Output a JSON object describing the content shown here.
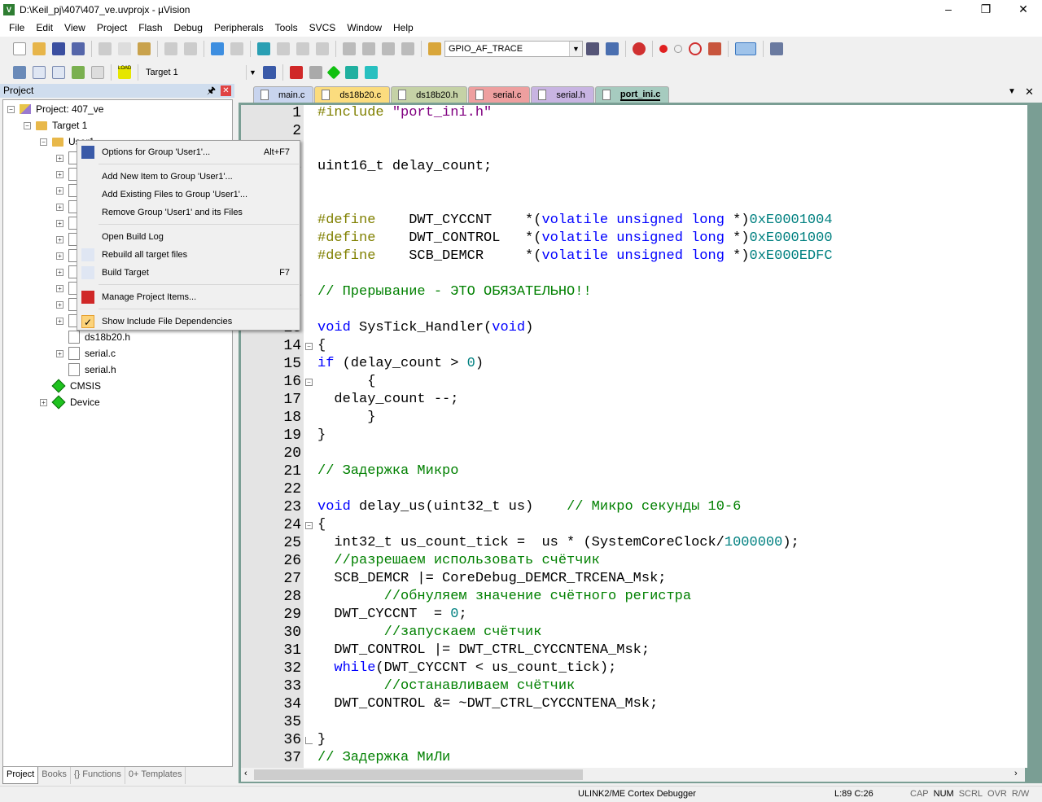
{
  "window": {
    "title": "D:\\Keil_pj\\407\\407_ve.uvprojx - µVision",
    "logo": "V",
    "controls": [
      "minimize-icon",
      "restore-icon",
      "close-icon"
    ]
  },
  "menubar": [
    "File",
    "Edit",
    "View",
    "Project",
    "Flash",
    "Debug",
    "Peripherals",
    "Tools",
    "SVCS",
    "Window",
    "Help"
  ],
  "toolbar1": {
    "find_combo": "GPIO_AF_TRACE"
  },
  "toolbar2": {
    "target_combo": "Target 1",
    "load_label": "LOAD"
  },
  "project_panel": {
    "title": "Project",
    "tree": [
      {
        "label": "Project: 407_ve",
        "level": 0,
        "icon": "project-icon",
        "expander": "minus"
      },
      {
        "label": "Target 1",
        "level": 1,
        "icon": "target-folder-icon",
        "expander": "minus"
      },
      {
        "label": "User1",
        "level": 2,
        "icon": "open-folder-icon",
        "expander": "minus"
      },
      {
        "label": "ds18b20.h",
        "level": 3,
        "icon": "file-icon",
        "expander": ""
      },
      {
        "label": "serial.c",
        "level": 3,
        "icon": "c-file-icon",
        "expander": "plus"
      },
      {
        "label": "serial.h",
        "level": 3,
        "icon": "file-icon",
        "expander": ""
      },
      {
        "label": "CMSIS",
        "level": 2,
        "icon": "component-icon",
        "expander": ""
      },
      {
        "label": "Device",
        "level": 2,
        "icon": "component-icon",
        "expander": "plus"
      }
    ],
    "bottom_tabs": [
      "Project",
      "Books",
      "{} Functions",
      "0+ Templates"
    ]
  },
  "context_menu": [
    {
      "label": "Options for Group 'User1'...",
      "shortcut": "Alt+F7",
      "icon": "magic-wand-icon"
    },
    {
      "sep": true
    },
    {
      "label": "Add New  Item to Group 'User1'...",
      "shortcut": ""
    },
    {
      "label": "Add Existing Files to Group 'User1'...",
      "shortcut": ""
    },
    {
      "label": "Remove Group 'User1' and its Files",
      "shortcut": ""
    },
    {
      "sep": true
    },
    {
      "label": "Open Build Log",
      "shortcut": ""
    },
    {
      "label": "Rebuild all target files",
      "shortcut": "",
      "icon": "rebuild-icon"
    },
    {
      "label": "Build Target",
      "shortcut": "F7",
      "icon": "build-icon"
    },
    {
      "sep": true
    },
    {
      "label": "Manage Project Items...",
      "shortcut": "",
      "icon": "manage-items-icon"
    },
    {
      "sep": true
    },
    {
      "label": "Show Include File Dependencies",
      "shortcut": "",
      "icon": "checkmark-icon",
      "checked": true
    }
  ],
  "editor_tabs": [
    {
      "label": "main.c",
      "color": "#c8d4ee"
    },
    {
      "label": "ds18b20.c",
      "color": "#fbdc7e"
    },
    {
      "label": "ds18b20.h",
      "color": "#c5d2a6"
    },
    {
      "label": "serial.c",
      "color": "#ee9f9f"
    },
    {
      "label": "serial.h",
      "color": "#c8b4e2"
    },
    {
      "label": "port_ini.c",
      "color": "#a6cbbf",
      "active": true
    }
  ],
  "colors": {
    "keyword": "#0000ff",
    "preprocessor": "#808000",
    "string": "#800080",
    "comment": "#008000",
    "number": "#008080"
  },
  "code": [
    [
      [
        "#include ",
        "pp"
      ],
      [
        "\"port_ini.h\"",
        "str"
      ]
    ],
    [],
    [],
    [
      [
        "uint16_t delay_count;",
        "tx"
      ]
    ],
    [],
    [],
    [
      [
        "#define",
        "pp"
      ],
      [
        "    DWT_CYCCNT    *(",
        "tx"
      ],
      [
        "volatile unsigned long",
        "kw"
      ],
      [
        " *)",
        "tx"
      ],
      [
        "0xE0001004",
        "num"
      ]
    ],
    [
      [
        "#define",
        "pp"
      ],
      [
        "    DWT_CONTROL   *(",
        "tx"
      ],
      [
        "volatile unsigned long",
        "kw"
      ],
      [
        " *)",
        "tx"
      ],
      [
        "0xE0001000",
        "num"
      ]
    ],
    [
      [
        "#define",
        "pp"
      ],
      [
        "    SCB_DEMCR     *(",
        "tx"
      ],
      [
        "volatile unsigned long",
        "kw"
      ],
      [
        " *)",
        "tx"
      ],
      [
        "0xE000EDFC",
        "num"
      ]
    ],
    [],
    [
      [
        "// Прерывание - ЭТО ОБЯЗАТЕЛЬНО!!",
        "cm"
      ]
    ],
    [],
    [
      [
        "void",
        "kw"
      ],
      [
        " SysTick_Handler(",
        "tx"
      ],
      [
        "void",
        "kw"
      ],
      [
        ")",
        "tx"
      ]
    ],
    [
      [
        "{",
        "tx"
      ]
    ],
    [
      [
        "if",
        "kw"
      ],
      [
        " (delay_count > ",
        "tx"
      ],
      [
        "0",
        "num"
      ],
      [
        ")",
        "tx"
      ]
    ],
    [
      [
        "      {",
        "tx"
      ]
    ],
    [
      [
        "  delay_count --;",
        "tx"
      ]
    ],
    [
      [
        "      }",
        "tx"
      ]
    ],
    [
      [
        "}",
        "tx"
      ]
    ],
    [],
    [
      [
        "// Задержка Микро",
        "cm"
      ]
    ],
    [],
    [
      [
        "void",
        "kw"
      ],
      [
        " delay_us(uint32_t us)    ",
        "tx"
      ],
      [
        "// Микро секунды 10-6",
        "cm"
      ]
    ],
    [
      [
        "{",
        "tx"
      ]
    ],
    [
      [
        "  int32_t us_count_tick =  us * (SystemCoreClock/",
        "tx"
      ],
      [
        "1000000",
        "num"
      ],
      [
        ");",
        "tx"
      ]
    ],
    [
      [
        "  //разрешаем использовать счётчик",
        "cm"
      ]
    ],
    [
      [
        "  SCB_DEMCR |= CoreDebug_DEMCR_TRCENA_Msk;",
        "tx"
      ]
    ],
    [
      [
        "        //обнуляем значение счётного регистра",
        "cm"
      ]
    ],
    [
      [
        "  DWT_CYCCNT  = ",
        "tx"
      ],
      [
        "0",
        "num"
      ],
      [
        ";",
        "tx"
      ]
    ],
    [
      [
        "        //запускаем счётчик",
        "cm"
      ]
    ],
    [
      [
        "  DWT_CONTROL |= DWT_CTRL_CYCCNTENA_Msk;",
        "tx"
      ]
    ],
    [
      [
        "  ",
        "tx"
      ],
      [
        "while",
        "kw"
      ],
      [
        "(DWT_CYCCNT < us_count_tick);",
        "tx"
      ]
    ],
    [
      [
        "        //останавливаем счётчик",
        "cm"
      ]
    ],
    [
      [
        "  DWT_CONTROL &= ~DWT_CTRL_CYCCNTENA_Msk;",
        "tx"
      ]
    ],
    [],
    [
      [
        "}",
        "tx"
      ]
    ],
    [
      [
        "// Задержка МиЛи",
        "cm"
      ]
    ]
  ],
  "fold_lines": [
    14,
    16,
    24,
    36
  ],
  "status": {
    "debugger": "ULINK2/ME Cortex Debugger",
    "position": "L:89 C:26",
    "indicators": [
      "CAP",
      "NUM",
      "SCRL",
      "OVR",
      "R/W"
    ]
  }
}
